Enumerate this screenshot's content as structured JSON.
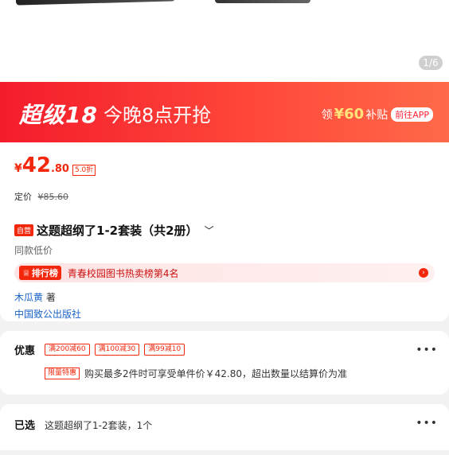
{
  "gallery": {
    "pager": "1/6"
  },
  "banner": {
    "title": "超级18",
    "subtitle": "今晚8点开抢",
    "coupon_prefix": "领",
    "coupon_amount": "¥60",
    "coupon_suffix": "补贴",
    "button": "前往APP"
  },
  "product": {
    "price_yen": "¥",
    "price_int": "42",
    "price_dec": ".80",
    "discount": "5.0折",
    "orig_label": "定价",
    "orig_price": "¥85.60",
    "self_tag": "自营",
    "title": "这题超纲了1-2套装（共2册）",
    "low_price": "同款低价",
    "rank_tag": "排行榜",
    "rank_text": "青春校园图书热卖榜第4名",
    "author": "木瓜黄",
    "author_suffix": "著",
    "publisher": "中国致公出版社"
  },
  "promo": {
    "label": "优惠",
    "coupons": [
      "满200减60",
      "满100减30",
      "满99减10"
    ],
    "limit_tag": "限量特惠",
    "limit_text": "购买最多2件时可享受单件价￥42.80，超出数量以结算价为准",
    "more": "•••"
  },
  "selected": {
    "label": "已选",
    "value": "这题超纲了1-2套装，1个",
    "more": "•••"
  }
}
